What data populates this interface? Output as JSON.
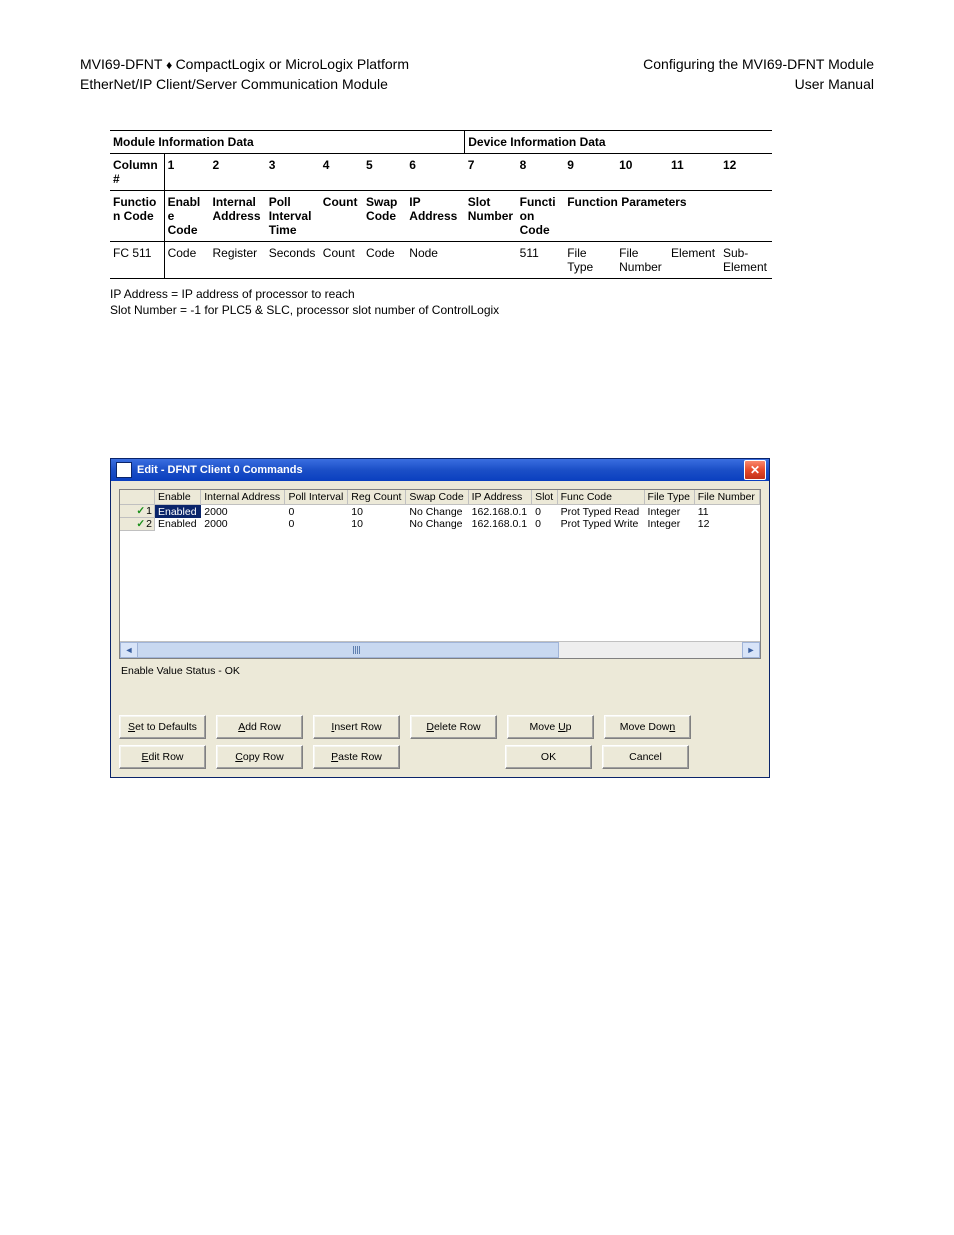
{
  "header": {
    "left1_a": "MVI69-DFNT",
    "left1_b": "CompactLogix or MicroLogix Platform",
    "left2": "EtherNet/IP Client/Server Communication Module",
    "right1": "Configuring the MVI69-DFNT Module",
    "right2": "User Manual"
  },
  "table": {
    "sectionA": "Module Information Data",
    "sectionB": "Device Information Data",
    "colnum_label": "Column #",
    "cols": [
      "1",
      "2",
      "3",
      "4",
      "5",
      "6",
      "7",
      "8",
      "9",
      "10",
      "11",
      "12"
    ],
    "func_label": "Function Code",
    "func_cols": [
      "Enable Code",
      "Internal Address",
      "Poll Interval Time",
      "Count",
      "Swap Code",
      "IP Address",
      "Slot Number",
      "Function Code",
      "Function Parameters",
      "",
      "",
      ""
    ],
    "row_label": "FC 511",
    "row": [
      "Code",
      "Register",
      "Seconds",
      "Count",
      "Code",
      "Node",
      "",
      "511",
      "File Type",
      "File Number",
      "Element",
      "Sub-Element"
    ]
  },
  "notes": {
    "l1": "IP Address = IP address of processor to reach",
    "l2": "Slot Number = -1 for PLC5 & SLC, processor slot number of ControlLogix"
  },
  "dialog": {
    "title": "Edit - DFNT Client 0 Commands",
    "headers": [
      "",
      "Enable",
      "Internal Address",
      "Poll Interval",
      "Reg Count",
      "Swap Code",
      "IP Address",
      "Slot",
      "Func Code",
      "File Type",
      "File Number"
    ],
    "rows": [
      {
        "n": "1",
        "enable": "Enabled",
        "ia": "2000",
        "pi": "0",
        "rc": "10",
        "sc": "No Change",
        "ip": "162.168.0.1",
        "slot": "0",
        "fc": "Prot Typed Read",
        "ft": "Integer",
        "fn": "11",
        "selected": true
      },
      {
        "n": "2",
        "enable": "Enabled",
        "ia": "2000",
        "pi": "0",
        "rc": "10",
        "sc": "No Change",
        "ip": "162.168.0.1",
        "slot": "0",
        "fc": "Prot Typed Write",
        "ft": "Integer",
        "fn": "12",
        "selected": false
      }
    ],
    "status": "Enable Value Status - OK",
    "buttons": {
      "set_defaults": "Set to Defaults",
      "add_row": "Add Row",
      "insert_row": "Insert Row",
      "delete_row": "Delete Row",
      "move_up": "Move Up",
      "move_down": "Move Down",
      "edit_row": "Edit Row",
      "copy_row": "Copy Row",
      "paste_row": "Paste Row",
      "ok": "OK",
      "cancel": "Cancel"
    }
  }
}
